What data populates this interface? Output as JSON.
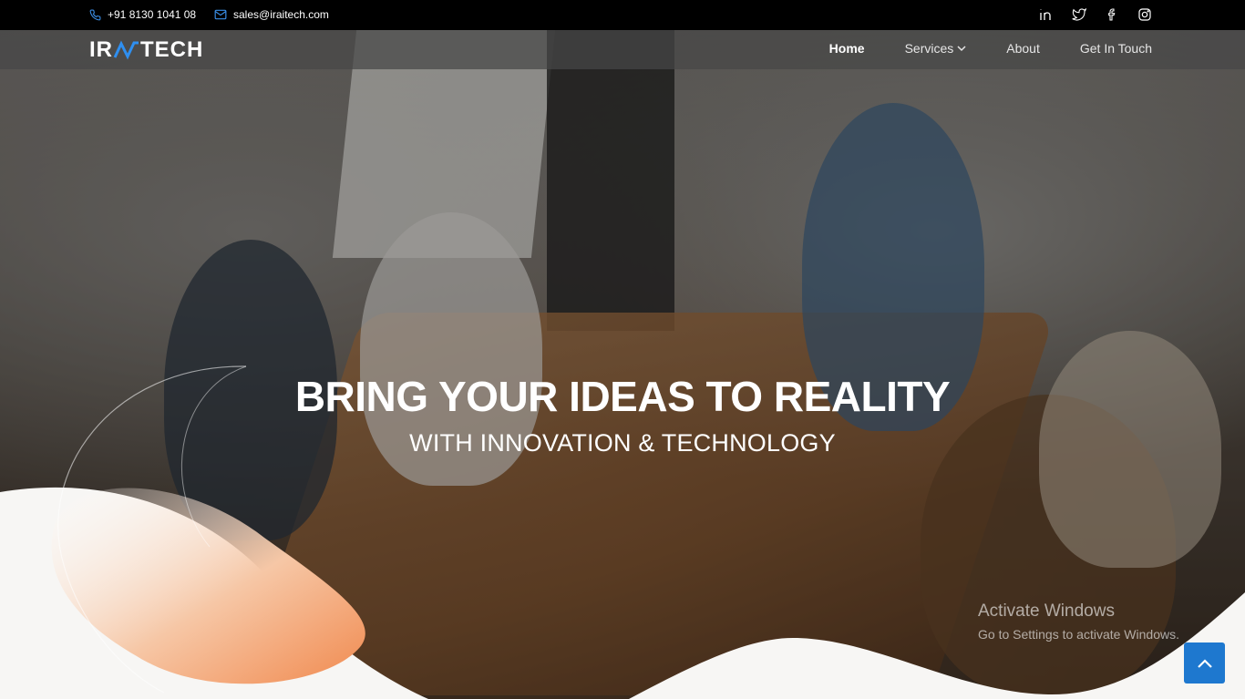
{
  "topbar": {
    "phone": "+91 8130 1041 08",
    "email": "sales@iraitech.com",
    "social_icons": [
      "linkedin-icon",
      "twitter-icon",
      "facebook-icon",
      "instagram-icon"
    ]
  },
  "brand": {
    "logo_left": "IR",
    "logo_right": "TECH"
  },
  "nav": {
    "items": [
      {
        "label": "Home",
        "active": true
      },
      {
        "label": "Services",
        "has_dropdown": true
      },
      {
        "label": "About"
      },
      {
        "label": "Get In Touch"
      }
    ]
  },
  "hero": {
    "headline": "BRING YOUR IDEAS TO REALITY",
    "subheadline": "WITH INNOVATION & TECHNOLOGY"
  },
  "watermark": {
    "title": "Activate Windows",
    "subtitle": "Go to Settings to activate Windows."
  },
  "colors": {
    "accent": "#1e78cf",
    "orange_blob": "#f4a06c",
    "topbar": "#000000"
  }
}
